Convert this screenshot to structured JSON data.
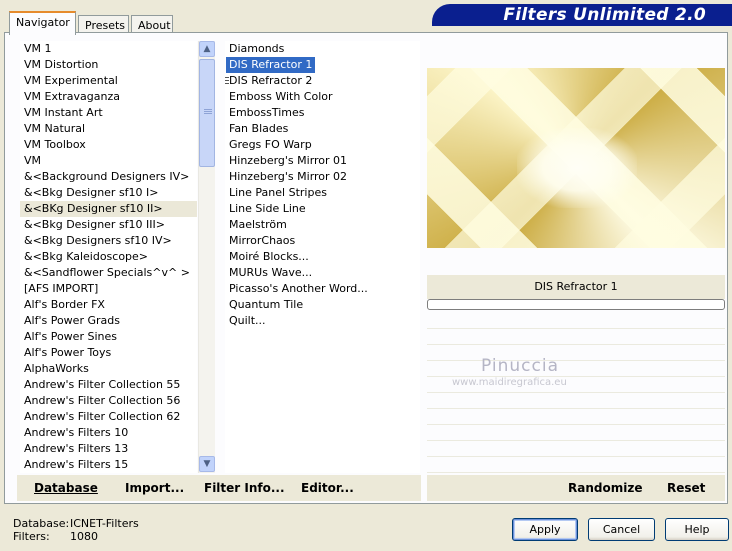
{
  "tabs": [
    {
      "label": "Navigator",
      "active": true
    },
    {
      "label": "Presets",
      "active": false
    },
    {
      "label": "About",
      "active": false
    }
  ],
  "banner_title": "Filters Unlimited 2.0",
  "categories": [
    "VM 1",
    "VM Distortion",
    "VM Experimental",
    "VM Extravaganza",
    "VM Instant Art",
    "VM Natural",
    "VM Toolbox",
    "VM",
    "&<Background Designers IV>",
    "&<Bkg Designer sf10 I>",
    "&<BKg Designer sf10 II>",
    "&<Bkg Designer sf10 III>",
    "&<Bkg Designers sf10 IV>",
    "&<Bkg Kaleidoscope>",
    "&<Sandflower Specials^v^ >",
    "[AFS IMPORT]",
    "Alf's Border FX",
    "Alf's Power Grads",
    "Alf's Power Sines",
    "Alf's Power Toys",
    "AlphaWorks",
    "Andrew's Filter Collection 55",
    "Andrew's Filter Collection 56",
    "Andrew's Filter Collection 62",
    "Andrew's Filters 10",
    "Andrew's Filters 13",
    "Andrew's Filters 15"
  ],
  "selected_category_index": 10,
  "filters": [
    "Diamonds",
    "DIS Refractor 1",
    "DIS Refractor 2",
    "Emboss With Color",
    "EmbossTimes",
    "Fan Blades",
    "Gregs FO Warp",
    "Hinzeberg's Mirror 01",
    "Hinzeberg's Mirror 02",
    "Line Panel Stripes",
    "Line Side Line",
    "Maelström",
    "MirrorChaos",
    "Moiré Blocks...",
    "MURUs Wave...",
    "Picasso's Another Word...",
    "Quantum Tile",
    "Quilt..."
  ],
  "selected_filter_index": 1,
  "toolbar_left": {
    "database": "Database",
    "import": "Import...",
    "filter_info": "Filter Info...",
    "editor": "Editor..."
  },
  "preview": {
    "filter_name": "DIS Refractor 1",
    "progress": 0
  },
  "watermark": {
    "name": "Pinuccia",
    "url": "www.maidiregrafica.eu"
  },
  "toolbar_right": {
    "randomize": "Randomize",
    "reset": "Reset"
  },
  "status": {
    "database_label": "Database:",
    "database_value": "ICNET-Filters",
    "filters_label": "Filters:",
    "filters_value": "1080"
  },
  "buttons": {
    "apply": "Apply",
    "cancel": "Cancel",
    "help": "Help"
  },
  "colors": {
    "selection_blue": "#316ac5",
    "banner_blue": "#0a1f8f",
    "tab_accent": "#e68b2c"
  }
}
